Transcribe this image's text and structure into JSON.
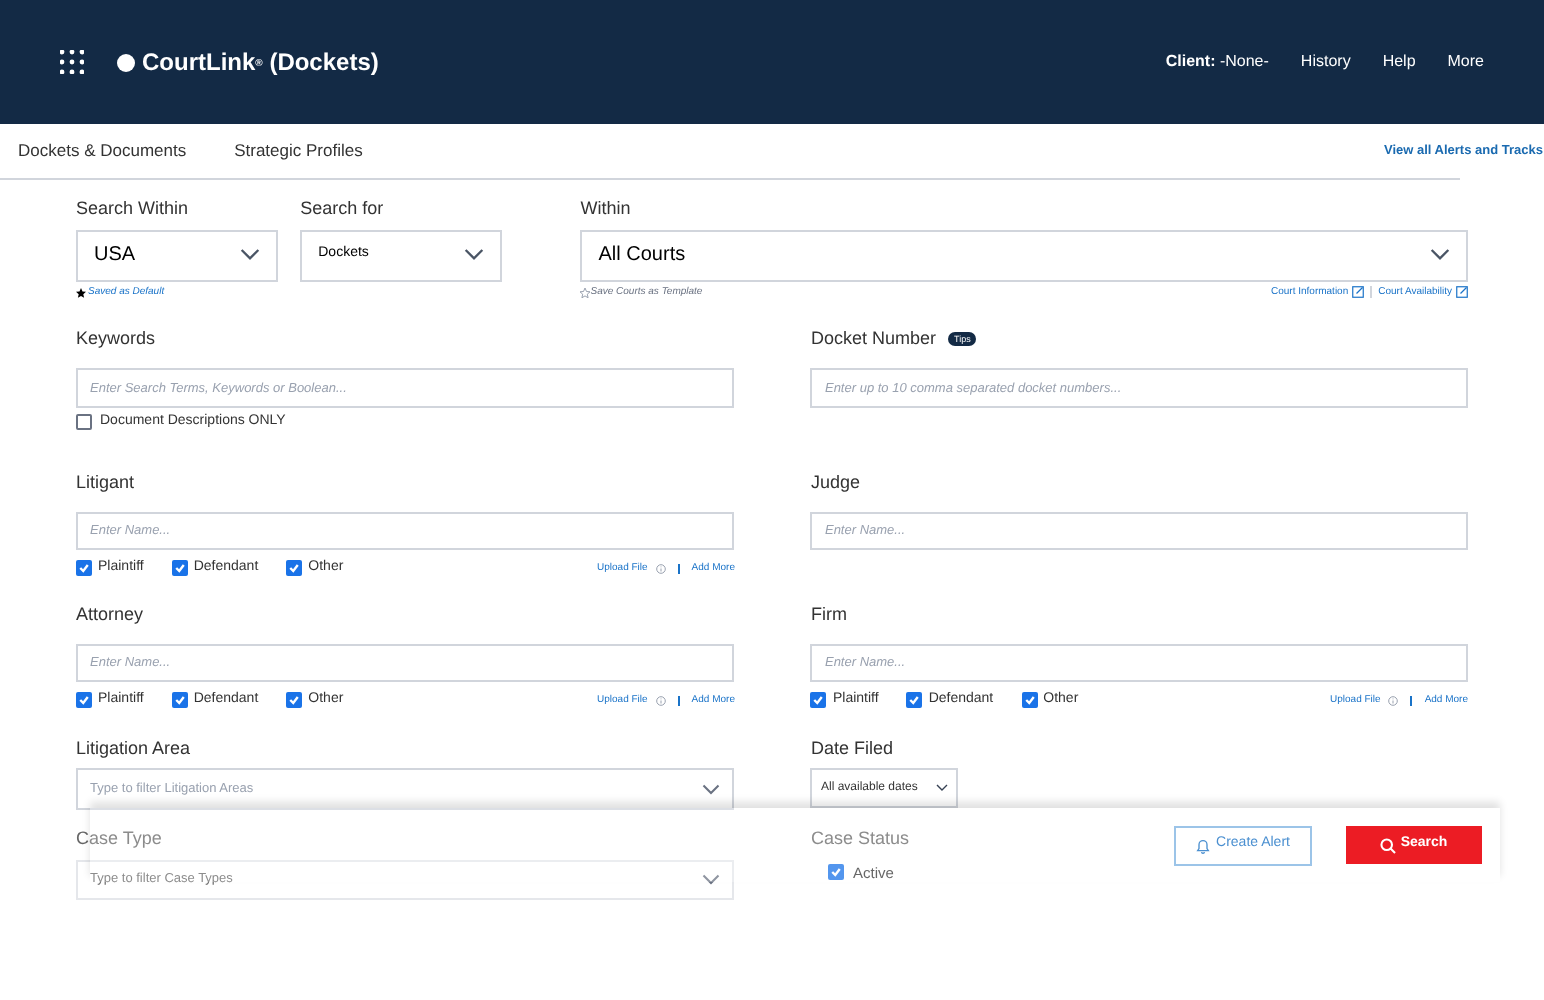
{
  "top_bar": {
    "app_title": "CourtLink",
    "app_mark": "®",
    "app_subtitle": "(Dockets)",
    "client_label": "Client:",
    "client_value": "-None-",
    "links": [
      "History",
      "Help",
      "More"
    ]
  },
  "nav": {
    "links": [
      "Dockets & Documents",
      "Strategic Profiles"
    ],
    "alerts_link": "View all Alerts and Tracks"
  },
  "search_within": {
    "label": "Search Within",
    "value": "USA",
    "note": "Saved as Default"
  },
  "search_for": {
    "label": "Search for",
    "value": "Dockets"
  },
  "within": {
    "label": "Within",
    "value": "All Courts",
    "note": "Save Courts as Template",
    "links": [
      "Court Information",
      "Court Availability"
    ]
  },
  "keywords": {
    "label": "Keywords",
    "placeholder": "Enter Search Terms, Keywords or Boolean...",
    "option": {
      "label": "Document Descriptions ONLY",
      "checked": false
    }
  },
  "docket_number": {
    "label": "Docket Number",
    "badge": "Tips",
    "placeholder": "Enter up to 10 comma separated docket numbers..."
  },
  "party_fields": [
    {
      "kind": "roles",
      "label": "Litigant",
      "placeholder": "Enter Name...",
      "roles": [
        {
          "label": "Plaintiff",
          "checked": true
        },
        {
          "label": "Defendant",
          "checked": true
        },
        {
          "label": "Other",
          "checked": true
        }
      ],
      "upload": "Upload File",
      "add_more": "Add More"
    },
    {
      "kind": "plain",
      "label": "Judge",
      "placeholder": "Enter Name..."
    },
    {
      "kind": "roles",
      "label": "Attorney",
      "placeholder": "Enter Name...",
      "roles": [
        {
          "label": "Plaintiff",
          "checked": true
        },
        {
          "label": "Defendant",
          "checked": true
        },
        {
          "label": "Other",
          "checked": true
        }
      ],
      "upload": "Upload File",
      "add_more": "Add More"
    },
    {
      "kind": "roles",
      "label": "Firm",
      "placeholder": "Enter Name...",
      "roles": [
        {
          "label": "Plaintiff",
          "checked": true
        },
        {
          "label": "Defendant",
          "checked": true
        },
        {
          "label": "Other",
          "checked": true
        }
      ],
      "upload": "Upload File",
      "add_more": "Add More"
    }
  ],
  "litigation_area": {
    "label": "Litigation Area",
    "placeholder": "Type to filter Litigation Areas"
  },
  "date_filed": {
    "label": "Date Filed",
    "value": "All available dates"
  },
  "case_type": {
    "label": "Case Type",
    "placeholder": "Type to filter Case Types"
  },
  "case_status": {
    "label": "Case Status",
    "options": [
      {
        "label": "Active",
        "checked": true
      }
    ]
  },
  "actions": [
    {
      "kind": "alert",
      "label": "Create Alert",
      "disabled": true
    },
    {
      "kind": "search",
      "label": "Search",
      "disabled": false
    }
  ]
}
